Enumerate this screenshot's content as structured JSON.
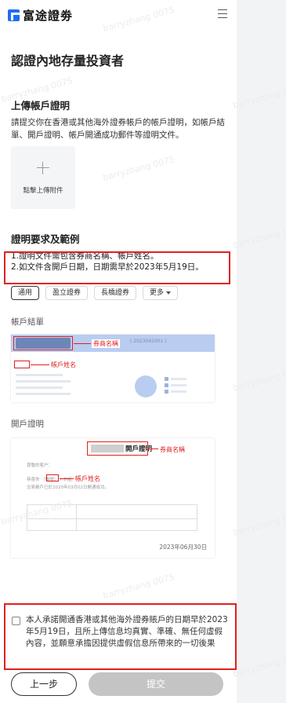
{
  "header": {
    "logo_text": "富途證劵"
  },
  "page_title": "認證內地存量投資者",
  "upload_section": {
    "title": "上傳帳戶證明",
    "description": "請提交你在香港或其他海外證券帳戶的帳戶證明，如帳戶結單、開戶證明、帳戶開通成功郵件等證明文件。",
    "upload_label": "點擊上傳附件"
  },
  "requirements": {
    "title": "證明要求及範例",
    "items": [
      "1.證明文件需包含券商名稱、帳戶姓名。",
      "2.如文件含開戶日期，日期需早於2023年5月19日。"
    ]
  },
  "tabs": [
    "通用",
    "盈立證券",
    "長橋證券",
    "更多"
  ],
  "samples": {
    "statement": {
      "label": "帳戶結單",
      "annot_broker": "券商名稱",
      "annot_name": "帳戶姓名",
      "code_text": "( 2023042001 )"
    },
    "proof": {
      "label": "開戶證明",
      "doc_title": "開戶證明",
      "annot_broker": "券商名稱",
      "annot_name": "帳戶姓名",
      "greeting": "尊敬的客户：",
      "line1": "恭喜你             （帳號：                     ）的証",
      "line2": "交易帳戶已於2020年03月02日開通成功。",
      "date": "2023年06月30日"
    }
  },
  "consent_text": "本人承諾開通香港或其他海外證券賬戶的日期早於2023年5月19日，且所上傳信息均真實、準確、無任何虛假內容，並願意承擔因提供虛假信息所帶來的一切後果",
  "buttons": {
    "prev": "上一步",
    "submit": "提交"
  },
  "watermark": "barryzhang 0075"
}
